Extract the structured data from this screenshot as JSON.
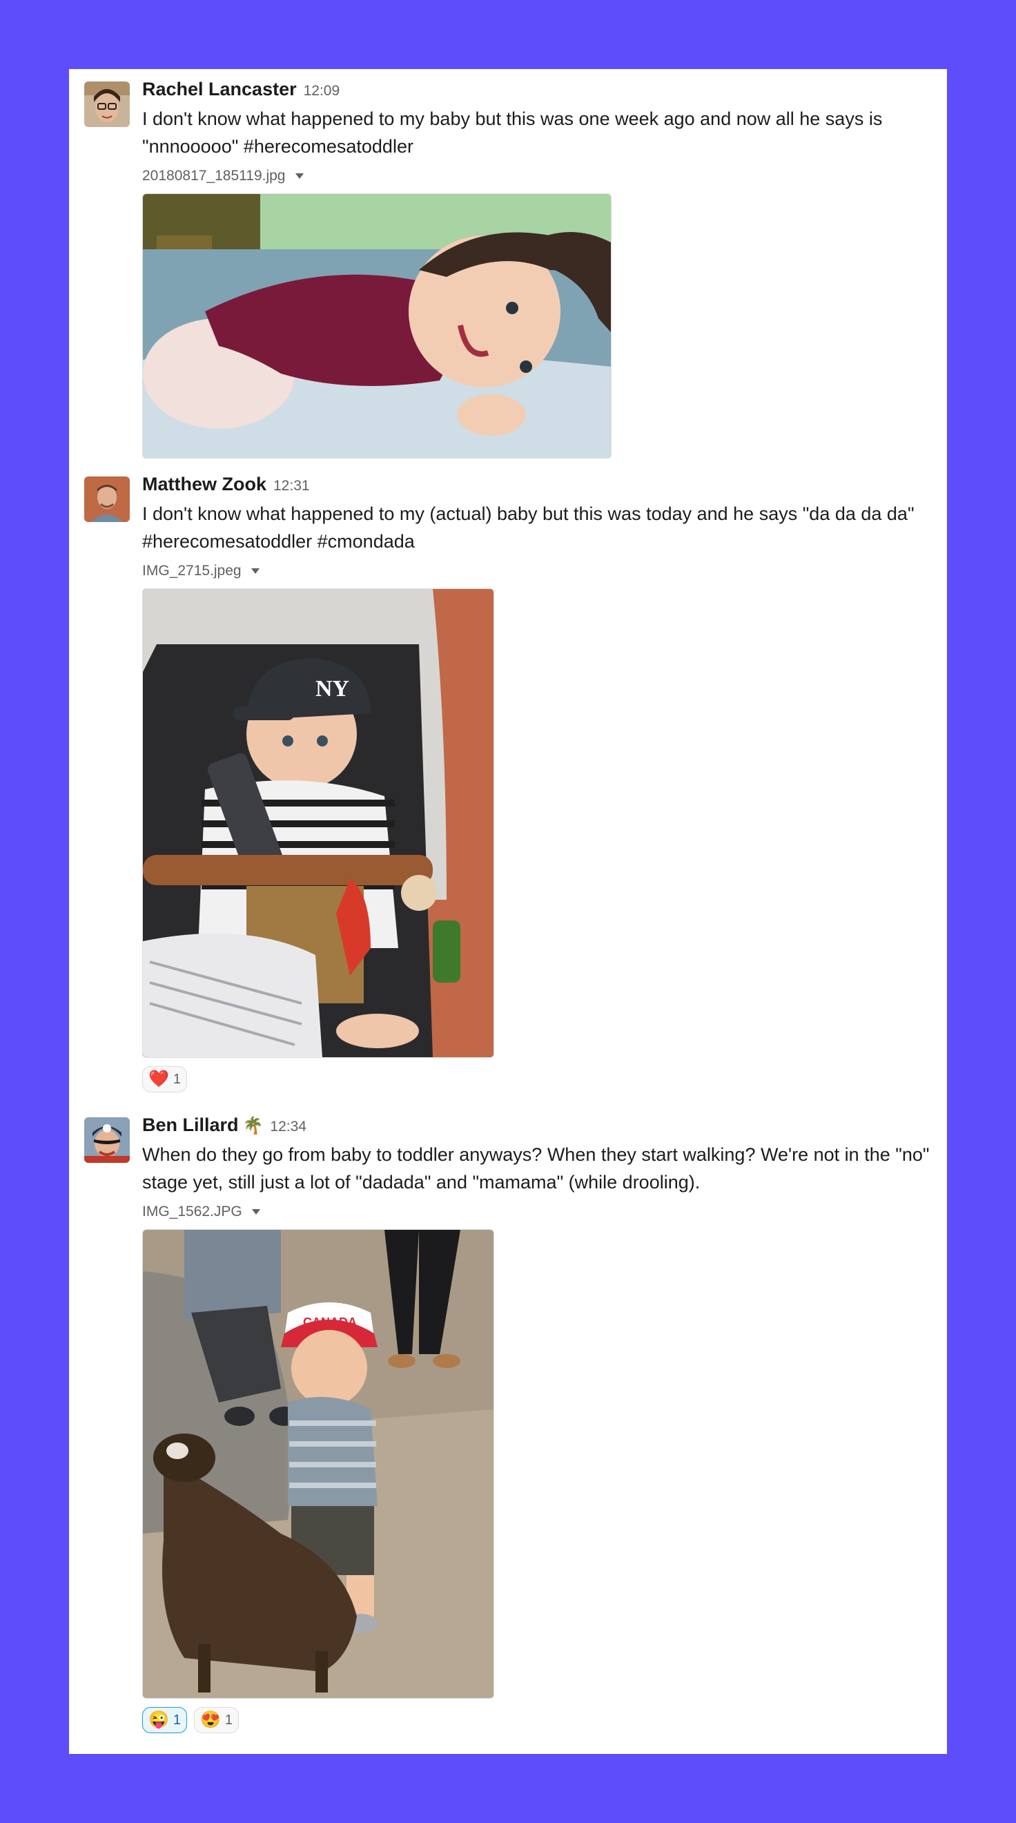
{
  "messages": [
    {
      "author": "Rachel Lancaster",
      "time": "12:09",
      "text": "I don't know what happened to my baby but this was one week ago and now all he says is \"nnnooooo\" #herecomesatoddler",
      "file": "20180817_185119.jpg"
    },
    {
      "author": "Matthew Zook",
      "time": "12:31",
      "text": "I don't know what happened to my (actual) baby but this was today and he says \"da da da da\" #herecomesatoddler #cmondada",
      "file": "IMG_2715.jpeg",
      "reactions": [
        {
          "emoji": "❤️",
          "count": "1"
        }
      ]
    },
    {
      "author": "Ben Lillard",
      "status_emoji": "🌴",
      "time": "12:34",
      "text": "When do they go from baby to toddler anyways? When they start walking? We're not in the \"no\" stage yet, still just a lot of \"dadada\" and \"mamama\" (while drooling).",
      "file": "IMG_1562.JPG",
      "reactions": [
        {
          "emoji": "😜",
          "count": "1"
        },
        {
          "emoji": "😍",
          "count": "1"
        }
      ]
    }
  ],
  "colors": {
    "background": "#5d4dfb",
    "card": "#ffffff",
    "accent": "#1264a3"
  }
}
